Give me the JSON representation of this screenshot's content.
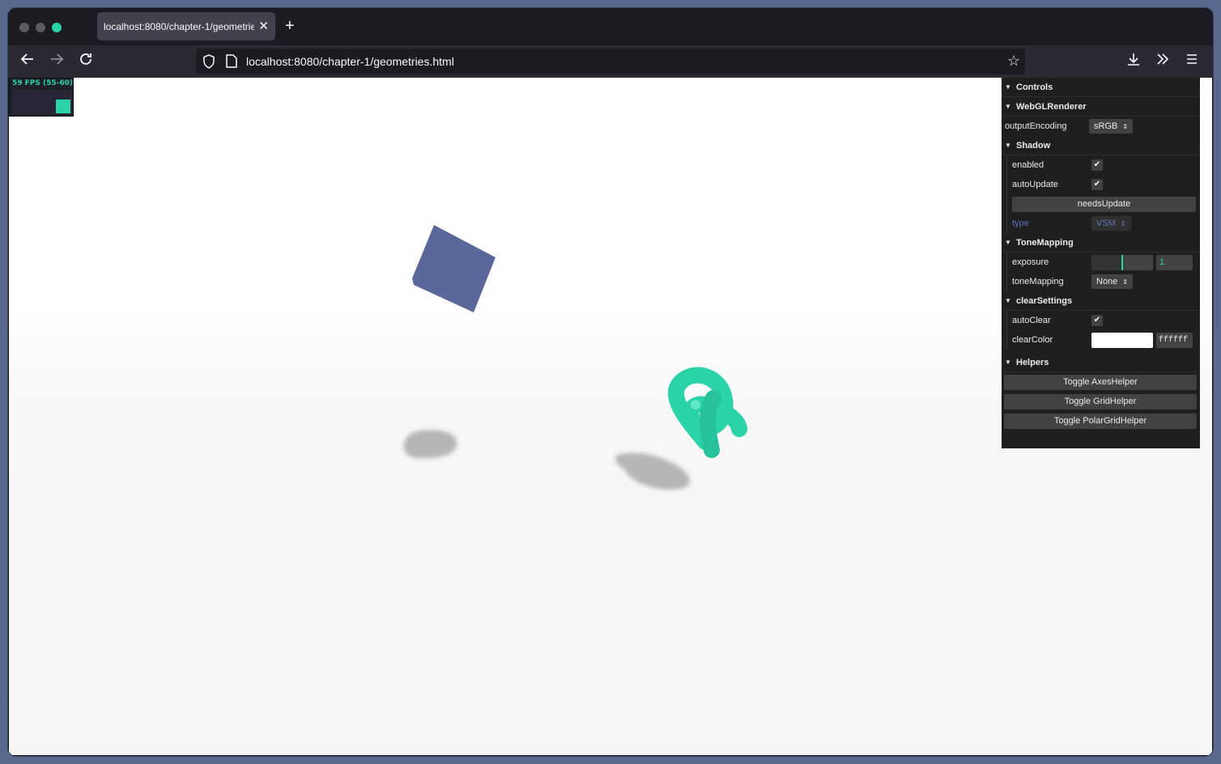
{
  "browser": {
    "tab_title": "localhost:8080/chapter-1/geometries.html",
    "url": "localhost:8080/chapter-1/geometries.html"
  },
  "stats": {
    "fps_text": "59 FPS (55-60)"
  },
  "gui": {
    "controls_title": "Controls",
    "renderer_title": "WebGLRenderer",
    "output_encoding_label": "outputEncoding",
    "output_encoding_value": "sRGB",
    "shadow_title": "Shadow",
    "enabled_label": "enabled",
    "enabled_checked": true,
    "auto_update_label": "autoUpdate",
    "auto_update_checked": true,
    "needs_update_label": "needsUpdate",
    "type_label": "type",
    "type_value": "VSM",
    "tone_mapping_title": "ToneMapping",
    "exposure_label": "exposure",
    "exposure_value": "1",
    "exposure_fraction": 0.5,
    "tone_mapping_label": "toneMapping",
    "tone_mapping_value": "None",
    "clear_settings_title": "clearSettings",
    "auto_clear_label": "autoClear",
    "auto_clear_checked": true,
    "clear_color_label": "clearColor",
    "clear_color_value": "ffffff",
    "helpers_title": "Helpers",
    "toggle_axes_label": "Toggle AxesHelper",
    "toggle_grid_label": "Toggle GridHelper",
    "toggle_polar_label": "Toggle PolarGridHelper"
  },
  "colors": {
    "cube": "#5b679a",
    "torus_knot": "#2bd4a8",
    "shadow": "#b5b5b5",
    "accent": "#2bd4a8"
  }
}
